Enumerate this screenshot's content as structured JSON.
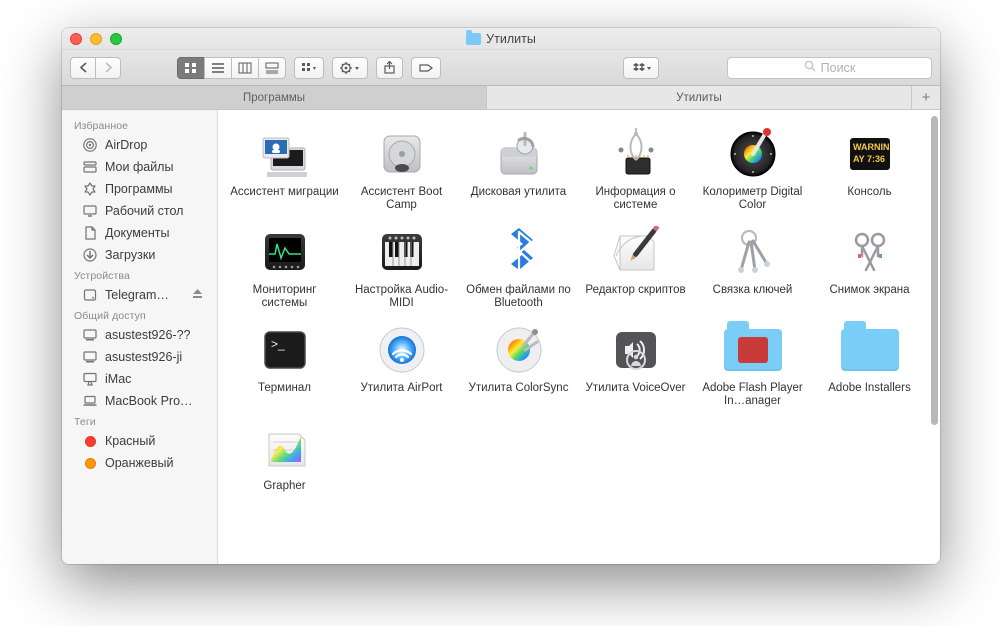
{
  "window": {
    "title": "Утилиты"
  },
  "search": {
    "placeholder": "Поиск"
  },
  "tabs": [
    {
      "label": "Программы",
      "active": false
    },
    {
      "label": "Утилиты",
      "active": true
    }
  ],
  "sidebar": {
    "sections": [
      {
        "title": "Избранное",
        "items": [
          {
            "icon": "airdrop",
            "label": "AirDrop"
          },
          {
            "icon": "allfiles",
            "label": "Мои файлы"
          },
          {
            "icon": "apps",
            "label": "Программы"
          },
          {
            "icon": "desktop",
            "label": "Рабочий стол"
          },
          {
            "icon": "documents",
            "label": "Документы"
          },
          {
            "icon": "downloads",
            "label": "Загрузки"
          }
        ]
      },
      {
        "title": "Устройства",
        "items": [
          {
            "icon": "disk",
            "label": "Telegram…",
            "eject": true
          }
        ]
      },
      {
        "title": "Общий доступ",
        "items": [
          {
            "icon": "computer",
            "label": "asustest926-??"
          },
          {
            "icon": "computer",
            "label": "asustest926-ji"
          },
          {
            "icon": "imac",
            "label": "iMac"
          },
          {
            "icon": "laptop",
            "label": "MacBook Pro…"
          }
        ]
      },
      {
        "title": "Теги",
        "items": [
          {
            "icon": "tag",
            "color": "#ff3b30",
            "label": "Красный"
          },
          {
            "icon": "tag",
            "color": "#ff9500",
            "label": "Оранжевый"
          }
        ]
      }
    ]
  },
  "grid": [
    {
      "icon": "migration",
      "label": "Ассистент миграции"
    },
    {
      "icon": "bootcamp",
      "label": "Ассистент Boot Camp"
    },
    {
      "icon": "diskutil",
      "label": "Дисковая утилита"
    },
    {
      "icon": "sysinfo",
      "label": "Информация о системе"
    },
    {
      "icon": "digitalcolor",
      "label": "Колориметр Digital Color"
    },
    {
      "icon": "console",
      "label": "Консоль"
    },
    {
      "icon": "activity",
      "label": "Мониторинг системы"
    },
    {
      "icon": "audiomidi",
      "label": "Настройка Audio-MIDI"
    },
    {
      "icon": "bluetooth",
      "label": "Обмен файлами по Bluetooth"
    },
    {
      "icon": "scripted",
      "label": "Редактор скриптов"
    },
    {
      "icon": "keychain",
      "label": "Связка ключей"
    },
    {
      "icon": "grab",
      "label": "Снимок экрана"
    },
    {
      "icon": "terminal",
      "label": "Терминал"
    },
    {
      "icon": "airport",
      "label": "Утилита AirPort"
    },
    {
      "icon": "colorsync",
      "label": "Утилита ColorSync"
    },
    {
      "icon": "voiceover",
      "label": "Утилита VoiceOver"
    },
    {
      "icon": "flashfolder",
      "label": "Adobe Flash Player In…anager"
    },
    {
      "icon": "folder",
      "label": "Adobe Installers"
    },
    {
      "icon": "grapher",
      "label": "Grapher"
    }
  ]
}
